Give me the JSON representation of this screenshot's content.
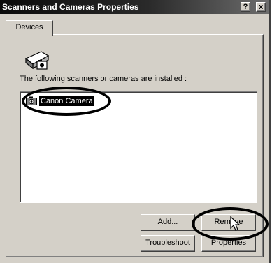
{
  "window": {
    "title": "Scanners and Cameras Properties",
    "help_label": "?",
    "close_label": "x"
  },
  "tabs": [
    {
      "label": "Devices"
    }
  ],
  "devices_panel": {
    "installed_label": "The following scanners or cameras are installed :",
    "devices": [
      {
        "name": "Canon Camera",
        "selected": true
      }
    ]
  },
  "buttons": {
    "add": "Add...",
    "remove": "Remove",
    "troubleshoot": "Troubleshoot",
    "properties": "Properties"
  },
  "icons": {
    "device_icon": "scanner-camera-icon",
    "list_icon": "camera-icon",
    "cursor": "arrow-cursor-icon"
  },
  "colors": {
    "dialog_face": "#d4d0c8",
    "selection": "#000000",
    "title_bar": "#0a0a0a"
  }
}
